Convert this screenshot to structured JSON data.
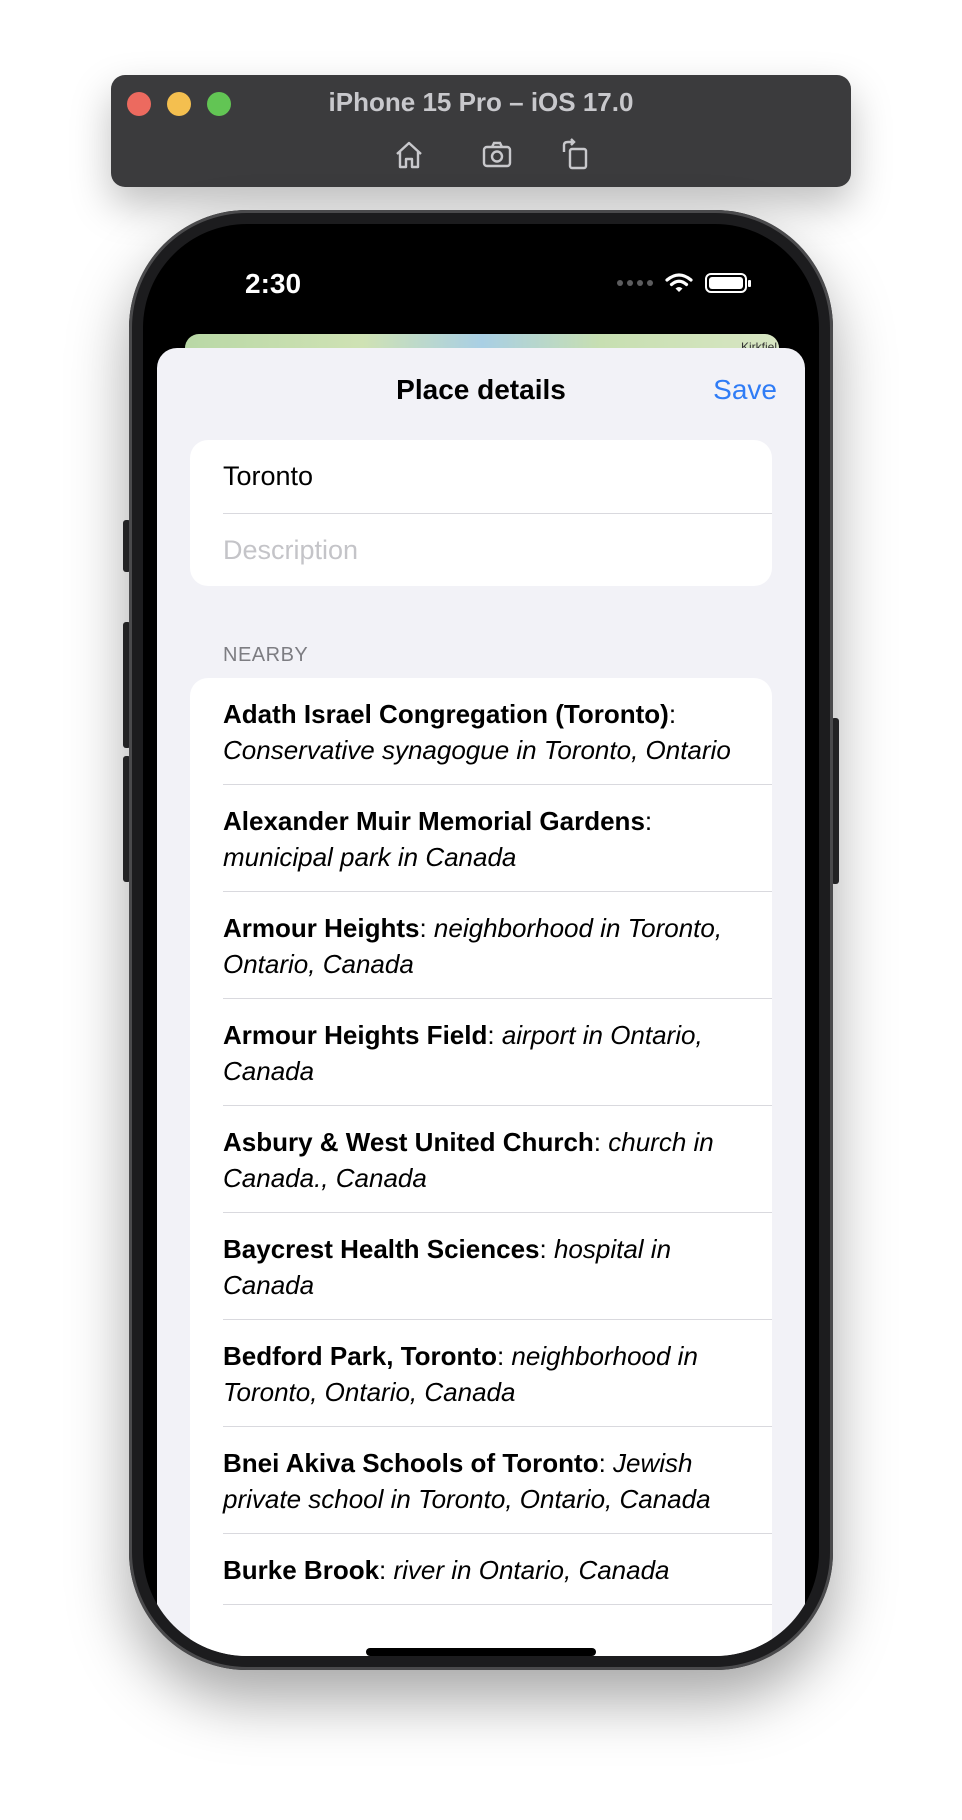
{
  "simulator": {
    "title": "iPhone 15 Pro – iOS 17.0",
    "buttons": [
      "home-icon",
      "screenshot-icon",
      "rotate-icon"
    ]
  },
  "status_bar": {
    "time": "2:30"
  },
  "map": {
    "label": "Kirkfiel"
  },
  "sheet": {
    "title": "Place details",
    "save_label": "Save",
    "name_value": "Toronto",
    "description_placeholder": "Description",
    "section_header": "NEARBY",
    "nearby": [
      {
        "name": "Adath Israel Congregation (Toronto)",
        "sep": ": ",
        "desc": "Conservative synagogue in Toronto, Ontario"
      },
      {
        "name": "Alexander Muir Memorial Gardens",
        "sep": ": ",
        "desc": "municipal park in Canada"
      },
      {
        "name": "Armour Heights",
        "sep": ": ",
        "desc": "neighborhood in Toronto, Ontario, Canada"
      },
      {
        "name": "Armour Heights Field",
        "sep": ": ",
        "desc": "airport in Ontario, Canada"
      },
      {
        "name": "Asbury & West United Church",
        "sep": ": ",
        "desc": "church in Canada., Canada"
      },
      {
        "name": "Baycrest Health Sciences",
        "sep": ": ",
        "desc": "hospital in Canada"
      },
      {
        "name": "Bedford Park, Toronto",
        "sep": ": ",
        "desc": "neighborhood in Toronto, Ontario, Canada"
      },
      {
        "name": "Bnei Akiva Schools of Toronto",
        "sep": ": ",
        "desc": "Jewish private school in Toronto, Ontario, Canada"
      },
      {
        "name": "Burke Brook",
        "sep": ": ",
        "desc": "river in Ontario, Canada"
      }
    ]
  },
  "colors": {
    "accent": "#2f7cf6",
    "sheet_bg": "#f2f2f7",
    "card_bg": "#ffffff"
  }
}
